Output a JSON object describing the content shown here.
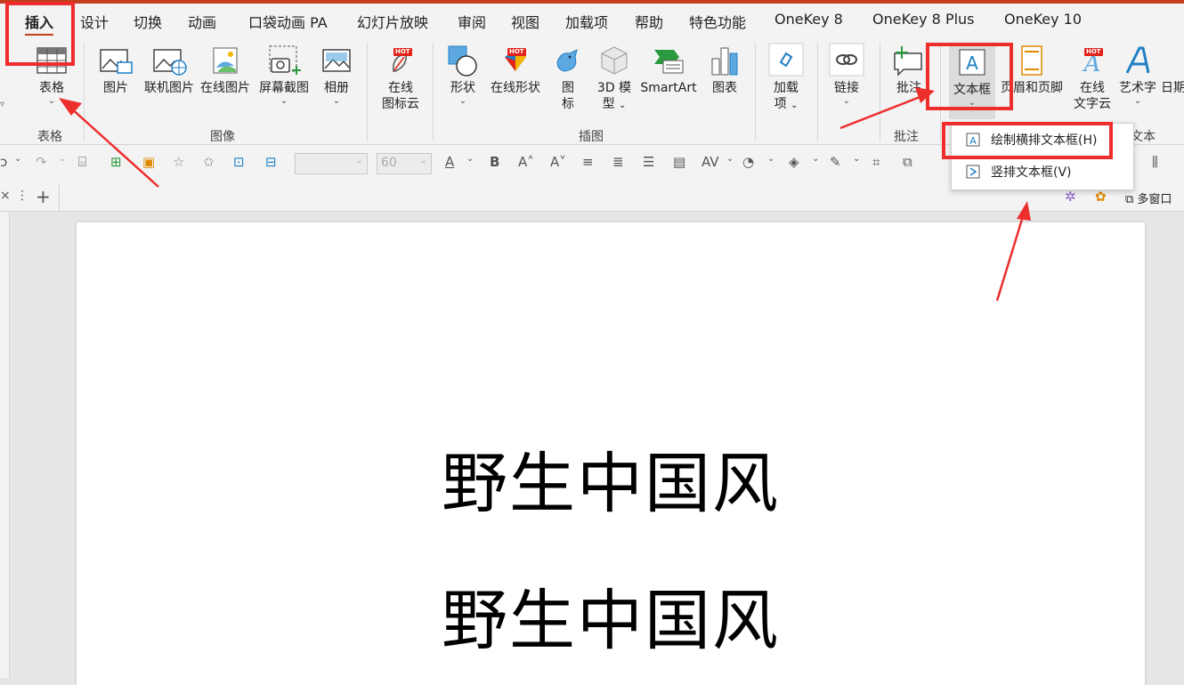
{
  "tabs": [
    "插入",
    "设计",
    "切换",
    "动画",
    "口袋动画 PA",
    "幻灯片放映",
    "审阅",
    "视图",
    "加载项",
    "帮助",
    "特色功能",
    "OneKey 8",
    "OneKey 8 Plus",
    "OneKey 10"
  ],
  "ribbon": {
    "table": {
      "label": "表格",
      "group": "表格"
    },
    "image": {
      "items": [
        "图片",
        "联机图片",
        "在线图片",
        "屏幕截图",
        "相册"
      ],
      "group": "图像"
    },
    "icon_cloud": {
      "line1": "在线",
      "line2": "图标云"
    },
    "illustration": {
      "shapes": "形状",
      "online_shapes": "在线形状",
      "icon_l1": "图",
      "icon_l2": "标",
      "model_l1": "3D 模",
      "model_l2": "型",
      "smartart": "SmartArt",
      "chart": "图表",
      "group": "插图"
    },
    "addins": {
      "line1": "加载",
      "line2": "项"
    },
    "link": "链接",
    "comment": {
      "label": "批注",
      "group": "批注"
    },
    "textbox": "文本框",
    "header_footer": "页眉和页脚",
    "wordcloud": {
      "line1": "在线",
      "line2": "文字云"
    },
    "wordart": "艺术字",
    "date": "日期",
    "text_group_partial": "文本",
    "hot": "HOT"
  },
  "toolbar2": {
    "font_size": "60"
  },
  "tabstrip": {
    "multi_window": "多窗口"
  },
  "dropdown": {
    "horizontal": "绘制横排文本框(H)",
    "vertical": "竖排文本框(V)"
  },
  "slide": {
    "line1": "野生中国风",
    "line2": "野生中国风"
  },
  "colors": {
    "accent": "#c43e1c",
    "annotation": "#ee2d2d"
  }
}
